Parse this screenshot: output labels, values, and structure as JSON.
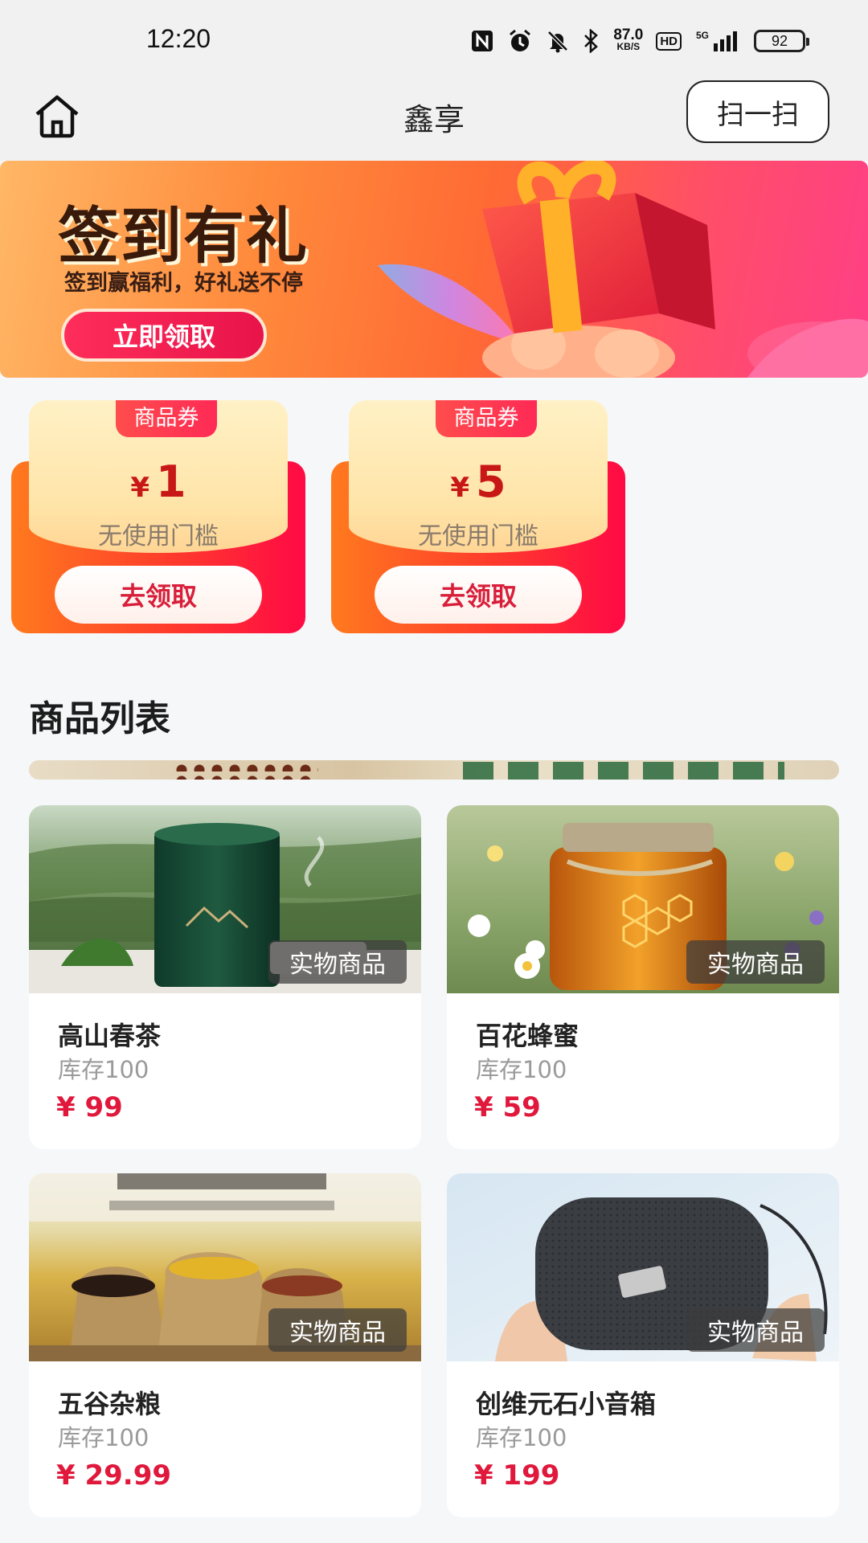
{
  "status_bar": {
    "time": "12:20",
    "net_speed": "87.0",
    "net_unit": "KB/S",
    "hd": "HD",
    "network": "5G",
    "battery": "92",
    "icons": [
      "nfc-icon",
      "alarm-icon",
      "mute-icon",
      "bluetooth-icon",
      "signal-icon"
    ]
  },
  "header": {
    "title": "鑫享",
    "scan_label": "扫一扫",
    "home_icon": "home-icon"
  },
  "banner": {
    "title": "签到有礼",
    "subtitle": "签到赢福利，好礼送不停",
    "button": "立即领取"
  },
  "coupons": [
    {
      "tag": "商品券",
      "currency": "¥",
      "amount": "1",
      "condition": "无使用门槛",
      "button": "去领取"
    },
    {
      "tag": "商品券",
      "currency": "¥",
      "amount": "5",
      "condition": "无使用门槛",
      "button": "去领取"
    }
  ],
  "product_section": {
    "title": "商品列表",
    "products": [
      {
        "tag": "实物商品",
        "name": "高山春茶",
        "stock": "库存100",
        "price": "¥ 99"
      },
      {
        "tag": "实物商品",
        "name": "百花蜂蜜",
        "stock": "库存100",
        "price": "¥ 59"
      },
      {
        "tag": "实物商品",
        "name": "五谷杂粮",
        "stock": "库存100",
        "price": "¥ 29.99"
      },
      {
        "tag": "实物商品",
        "name": "创维元石小音箱",
        "stock": "库存100",
        "price": "¥ 199"
      }
    ]
  },
  "colors": {
    "accent_red": "#e0183c",
    "coupon_red": "#c81717",
    "page_bg": "#f6f7f9"
  }
}
